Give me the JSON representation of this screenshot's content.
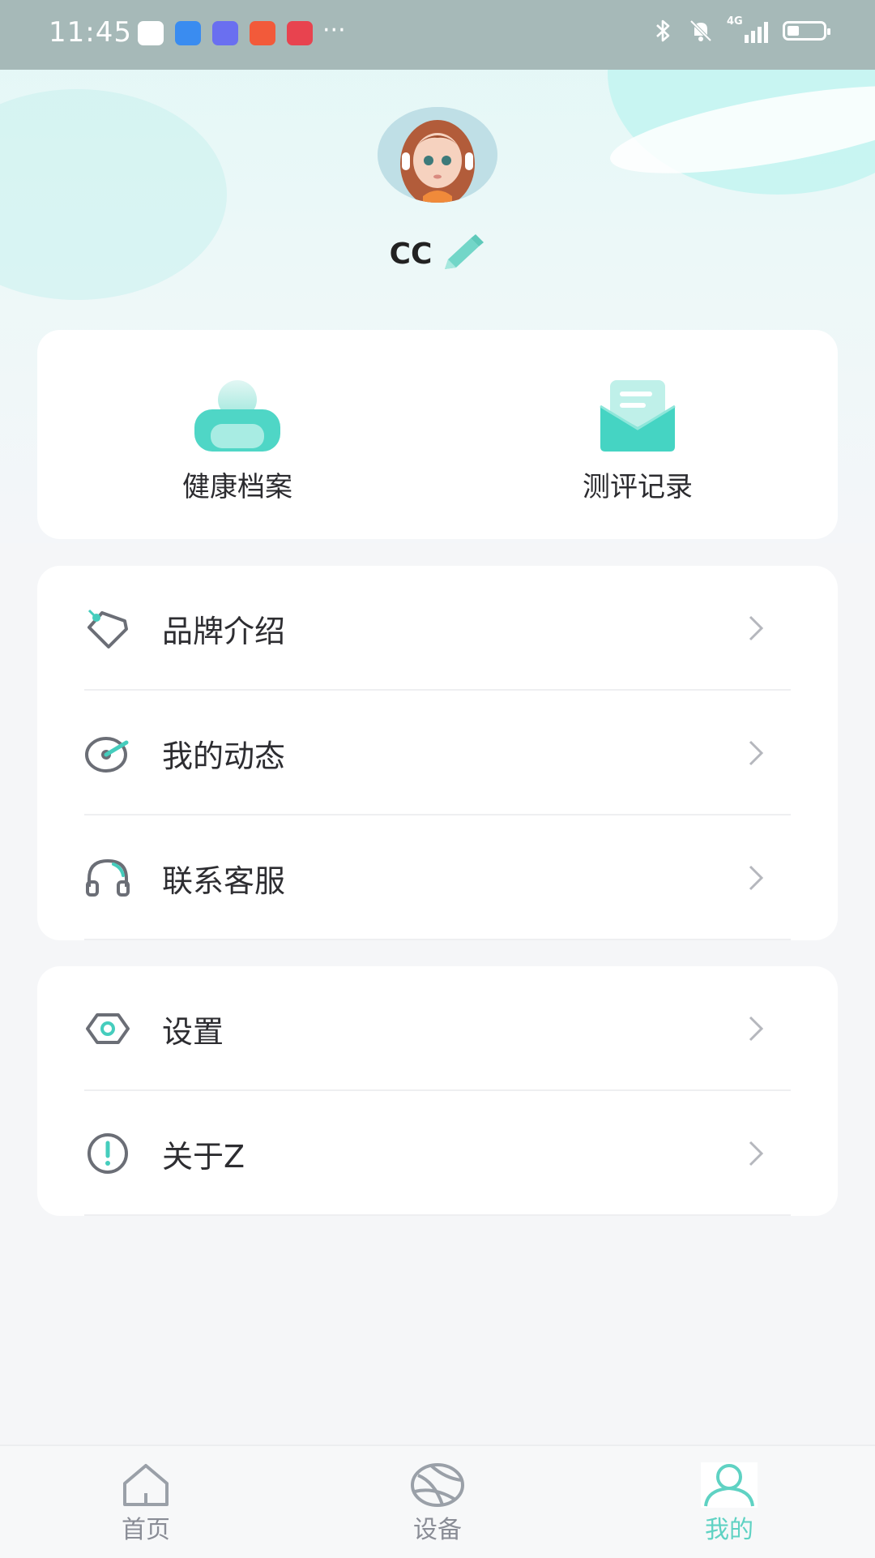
{
  "status_bar": {
    "time": "11:45",
    "more": "···",
    "network": "4G"
  },
  "profile": {
    "username": "CC",
    "avatar_icon": "avatar-image",
    "edit_icon": "pencil-icon"
  },
  "quick_actions": [
    {
      "label": "健康档案",
      "icon": "health-record-icon"
    },
    {
      "label": "测评记录",
      "icon": "assessment-record-icon"
    }
  ],
  "menu_group_1": [
    {
      "label": "品牌介绍",
      "icon": "tag-icon"
    },
    {
      "label": "我的动态",
      "icon": "activity-icon"
    },
    {
      "label": "联系客服",
      "icon": "headset-icon"
    }
  ],
  "menu_group_2": [
    {
      "label": "设置",
      "icon": "settings-icon"
    },
    {
      "label": "关于Z",
      "icon": "info-icon"
    }
  ],
  "tab_bar": {
    "tabs": [
      {
        "label": "首页",
        "icon": "home-icon"
      },
      {
        "label": "设备",
        "icon": "device-icon"
      },
      {
        "label": "我的",
        "icon": "profile-icon"
      }
    ],
    "active": "我的"
  },
  "colors": {
    "accent": "#5fd2c3",
    "status_bar": "#a6b9b8",
    "text_primary": "#2d2d31",
    "icon_gray": "#6b6e76"
  }
}
